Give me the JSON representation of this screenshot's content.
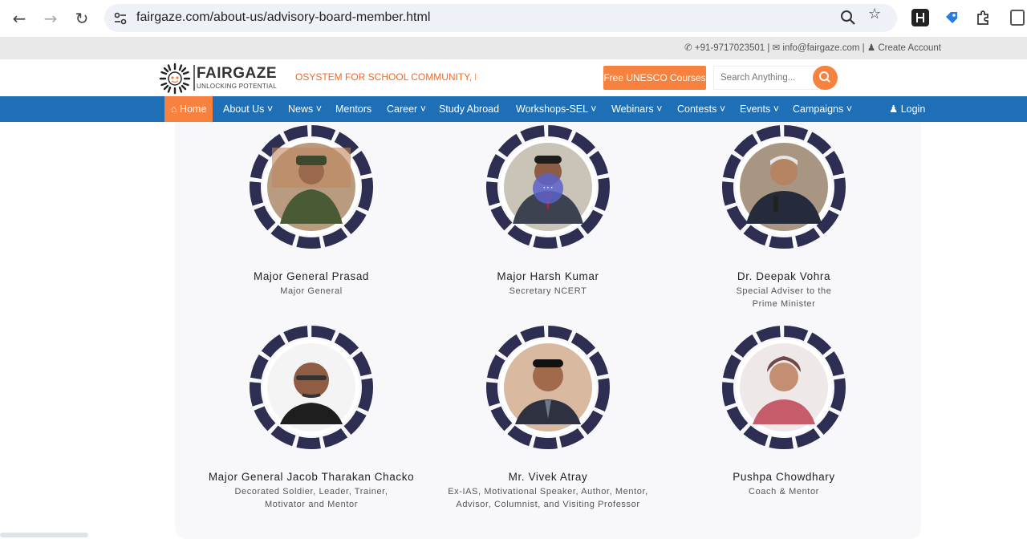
{
  "browser": {
    "url": "fairgaze.com/about-us/advisory-board-member.html"
  },
  "topbar": {
    "phone": "+91-9717023501",
    "email": "info@fairgaze.com",
    "create_account": "Create Account"
  },
  "header": {
    "logo_word": "FAIRGAZE",
    "logo_tagline": "UNLOCKING POTENTIAL",
    "marquee": "OSYSTEM FOR SCHOOL COMMUNITY, M",
    "unesco_button": "Free UNESCO Courses",
    "search_placeholder": "Search Anything..."
  },
  "nav": {
    "items": [
      {
        "label": "Home"
      },
      {
        "label": "About Us"
      },
      {
        "label": "News"
      },
      {
        "label": "Mentors"
      },
      {
        "label": "Career"
      },
      {
        "label": "Study Abroad"
      },
      {
        "label": "Workshops-SEL"
      },
      {
        "label": "Webinars"
      },
      {
        "label": "Contests"
      },
      {
        "label": "Events"
      },
      {
        "label": "Campaigns"
      },
      {
        "label": "Login"
      }
    ]
  },
  "members": [
    {
      "name": "Major General Prasad",
      "role": "Major General"
    },
    {
      "name": "Major Harsh Kumar",
      "role": "Secretary NCERT"
    },
    {
      "name": "Dr. Deepak Vohra",
      "role": "Special Adviser to the Prime Minister"
    },
    {
      "name": "Major General Jacob Tharakan Chacko",
      "role": "Decorated Soldier, Leader, Trainer, Motivator and Mentor"
    },
    {
      "name": "Mr. Vivek Atray",
      "role": "Ex-IAS, Motivational Speaker, Author, Mentor, Advisor, Columnist, and Visiting Professor"
    },
    {
      "name": "Pushpa Chowdhary",
      "role": "Coach & Mentor"
    }
  ],
  "colors": {
    "brand_orange": "#f7813e",
    "nav_blue": "#1f6fb6",
    "frame_navy": "#2e2d52"
  },
  "icons": {
    "back": "arrow-left-icon",
    "forward": "arrow-right-icon",
    "reload": "reload-icon",
    "site_info": "tune-icon",
    "zoom": "magnifier-icon",
    "bookmark": "star-icon",
    "phone": "phone-icon",
    "mail": "envelope-icon",
    "user": "user-icon",
    "search": "search-icon",
    "home": "home-icon"
  }
}
